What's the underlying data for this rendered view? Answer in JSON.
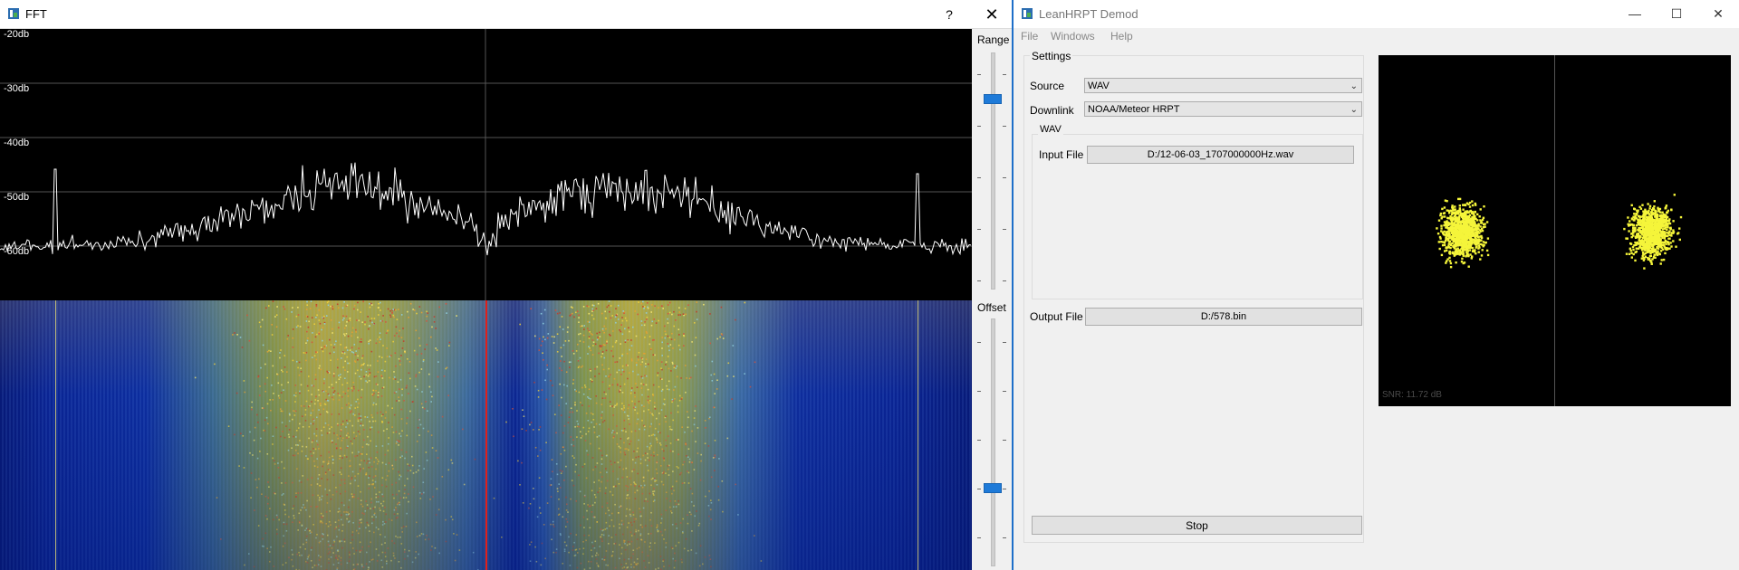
{
  "fft_window": {
    "title": "FFT",
    "help_button": "?",
    "close_button": "✕",
    "db_labels": [
      "-20db",
      "-30db",
      "-40db",
      "-50db",
      "-60db"
    ],
    "range_label": "Range",
    "offset_label": "Offset",
    "icon": "app-icon"
  },
  "lean_window": {
    "title": "LeanHRPT Demod",
    "minimize": "—",
    "maximize": "☐",
    "close": "✕",
    "menu": [
      "File",
      "Windows",
      "Help"
    ],
    "settings": {
      "group_title": "Settings",
      "source_label": "Source",
      "source_value": "WAV",
      "downlink_label": "Downlink",
      "downlink_value": "NOAA/Meteor HRPT",
      "wav_group_title": "WAV",
      "input_file_label": "Input File",
      "input_file_value": "D:/12-06-03_1707000000Hz.wav",
      "output_file_label": "Output File",
      "output_file_value": "D:/578.bin",
      "stop_label": "Stop"
    },
    "snr": "SNR: 11.72 dB"
  },
  "colors": {
    "accent": "#1e7ad8",
    "constellation_points": "#f5f53a",
    "spectrum_trace": "#ffffff",
    "center_marker": "#e0201a"
  }
}
